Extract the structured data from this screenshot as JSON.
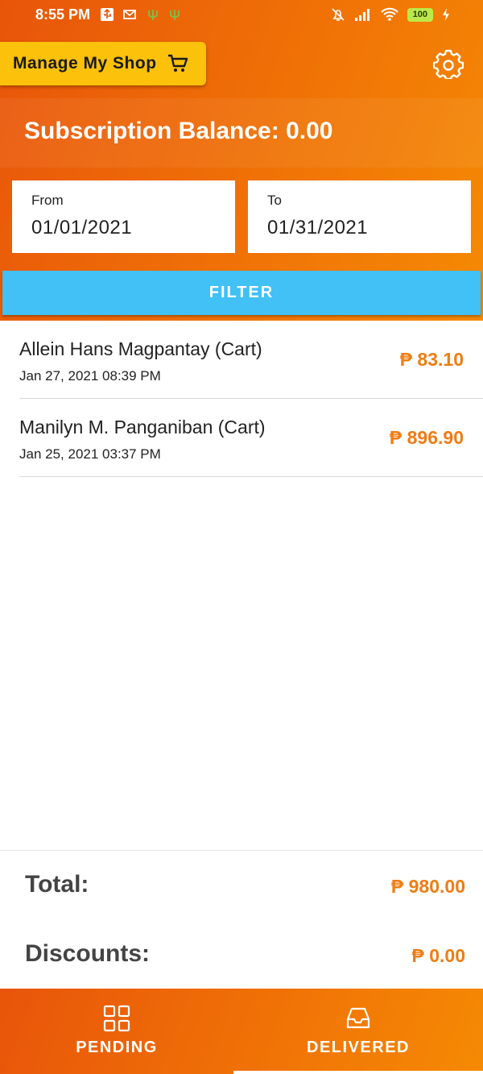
{
  "status_bar": {
    "time": "8:55 PM",
    "battery": "100"
  },
  "header": {
    "manage_label": "Manage My Shop"
  },
  "balance": {
    "text": "Subscription Balance: 0.00"
  },
  "filters": {
    "from_label": "From",
    "from_value": "01/01/2021",
    "to_label": "To",
    "to_value": "01/31/2021",
    "filter_label": "FILTER"
  },
  "orders": [
    {
      "name": "Allein Hans Magpantay (Cart)",
      "date": "Jan 27, 2021 08:39 PM",
      "amount": "₱ 83.10"
    },
    {
      "name": "Manilyn M. Panganiban (Cart)",
      "date": "Jan 25, 2021 03:37 PM",
      "amount": "₱ 896.90"
    }
  ],
  "totals": {
    "total_label": "Total:",
    "total_value": "₱ 980.00",
    "discounts_label": "Discounts:",
    "discounts_value": "₱ 0.00"
  },
  "nav": {
    "pending": "PENDING",
    "delivered": "DELIVERED",
    "active": "delivered"
  },
  "colors": {
    "brand_orange": "#f07206",
    "accent_yellow": "#fbc10b",
    "filter_blue": "#41c1f5",
    "amount_orange": "#ee7d14"
  }
}
